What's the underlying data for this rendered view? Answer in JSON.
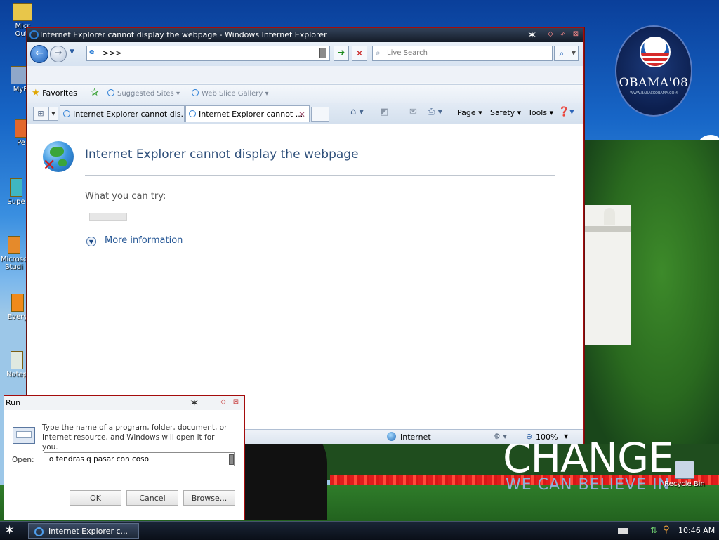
{
  "desktop": {
    "icons": [
      {
        "name": "Micr Outl",
        "label": "Micr\nOutl"
      },
      {
        "name": "MyP",
        "label": "MyP"
      },
      {
        "name": "Pe",
        "label": "Pe"
      },
      {
        "name": "Supe",
        "label": "Supe"
      },
      {
        "name": "Microsoft Studio",
        "label": "Microso\nStudi"
      },
      {
        "name": "Every",
        "label": "Every"
      },
      {
        "name": "Notep",
        "label": "Notep"
      }
    ],
    "recycle_bin": "Recycle Bin",
    "wallpaper": {
      "logo_text": "OBAMA'08",
      "logo_sub": "WWW.BARACKOBAMA.COM",
      "headline": "CHANGE",
      "tagline": "WE CAN BELIEVE IN"
    }
  },
  "ie": {
    "title": "Internet Explorer cannot display the webpage - Windows Internet Explorer",
    "address": ">>>",
    "search_placeholder": "Live Search",
    "favorites_label": "Favorites",
    "suggested_sites": "Suggested Sites",
    "web_slice_gallery": "Web Slice Gallery",
    "tabs": [
      {
        "label": "Internet Explorer cannot dis...",
        "active": false
      },
      {
        "label": "Internet Explorer cannot ...",
        "active": true
      }
    ],
    "commands": {
      "page": "Page",
      "safety": "Safety",
      "tools": "Tools"
    },
    "error": {
      "title": "Internet Explorer cannot display the webpage",
      "try_label": "What you can try:",
      "more_info": "More information"
    },
    "status": {
      "zone": "Internet",
      "zoom": "100%"
    }
  },
  "run": {
    "title": "Run",
    "description": "Type the name of a program, folder, document, or Internet resource, and Windows will open it for you.",
    "open_label": "Open:",
    "open_value": "lo tendras q pasar con coso",
    "ok": "OK",
    "cancel": "Cancel",
    "browse": "Browse..."
  },
  "taskbar": {
    "task_label": "Internet Explorer c...",
    "clock": "10:46 AM"
  },
  "colors": {
    "window_border": "#a40c0c",
    "titlebar": "#1d2636",
    "link": "#2a5a97"
  }
}
